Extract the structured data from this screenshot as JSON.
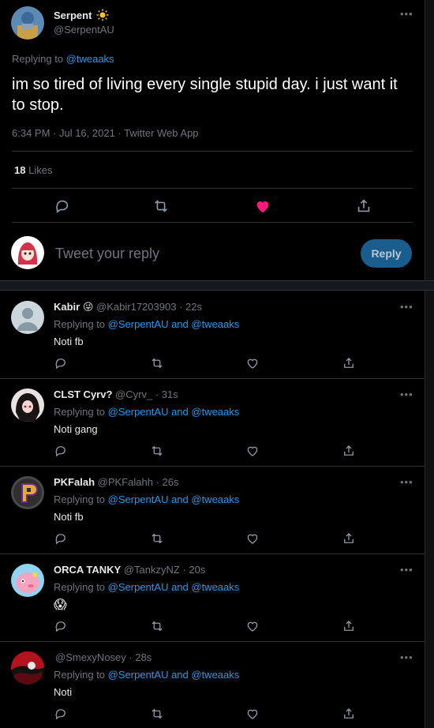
{
  "colors": {
    "background": "#000000",
    "accent": "#1d9bf0",
    "like": "#f91880",
    "muted": "#6e767d"
  },
  "main_tweet": {
    "author_name": "Serpent",
    "author_badge_icon": "sun-icon",
    "author_handle": "@SerpentAU",
    "replying_prefix": "Replying to",
    "replying_to": "@tweaaks",
    "text": "im so tired of living every single stupid day. i just want it to stop.",
    "meta": "6:34 PM · Jul 16, 2021 · Twitter Web App",
    "likes_count": "18",
    "likes_label": "Likes",
    "liked": true
  },
  "reply_box": {
    "placeholder": "Tweet your reply",
    "button_label": "Reply"
  },
  "replies": [
    {
      "name": "Kabir",
      "emoji": "😜",
      "handle": "@Kabir17203903",
      "time": "· 22s",
      "replying_prefix": "Replying to",
      "replying_to": "@SerpentAU and @tweaaks",
      "text": "Noti fb"
    },
    {
      "name": "CLST Cyrv?",
      "emoji": "",
      "handle": "@Cyrv_",
      "time": "· 31s",
      "replying_prefix": "Replying to",
      "replying_to": "@SerpentAU and @tweaaks",
      "text": "Noti gang"
    },
    {
      "name": "PKFalah",
      "emoji": "",
      "handle": "@PKFalahh",
      "time": "· 26s",
      "replying_prefix": "Replying to",
      "replying_to": "@SerpentAU and @tweaaks",
      "text": "Noti fb"
    },
    {
      "name": "ORCA TANKY",
      "emoji": "",
      "handle": "@TankzyNZ",
      "time": "· 20s",
      "replying_prefix": "Replying to",
      "replying_to": "@SerpentAU and @tweaaks",
      "text": "😱"
    },
    {
      "name": "",
      "emoji": "",
      "handle": "@SmexyNosey",
      "time": "· 28s",
      "replying_prefix": "Replying to",
      "replying_to": "@SerpentAU and @tweaaks",
      "text": "Noti"
    }
  ],
  "icons": [
    "more-icon",
    "reply-icon",
    "retweet-icon",
    "like-icon",
    "share-icon"
  ]
}
